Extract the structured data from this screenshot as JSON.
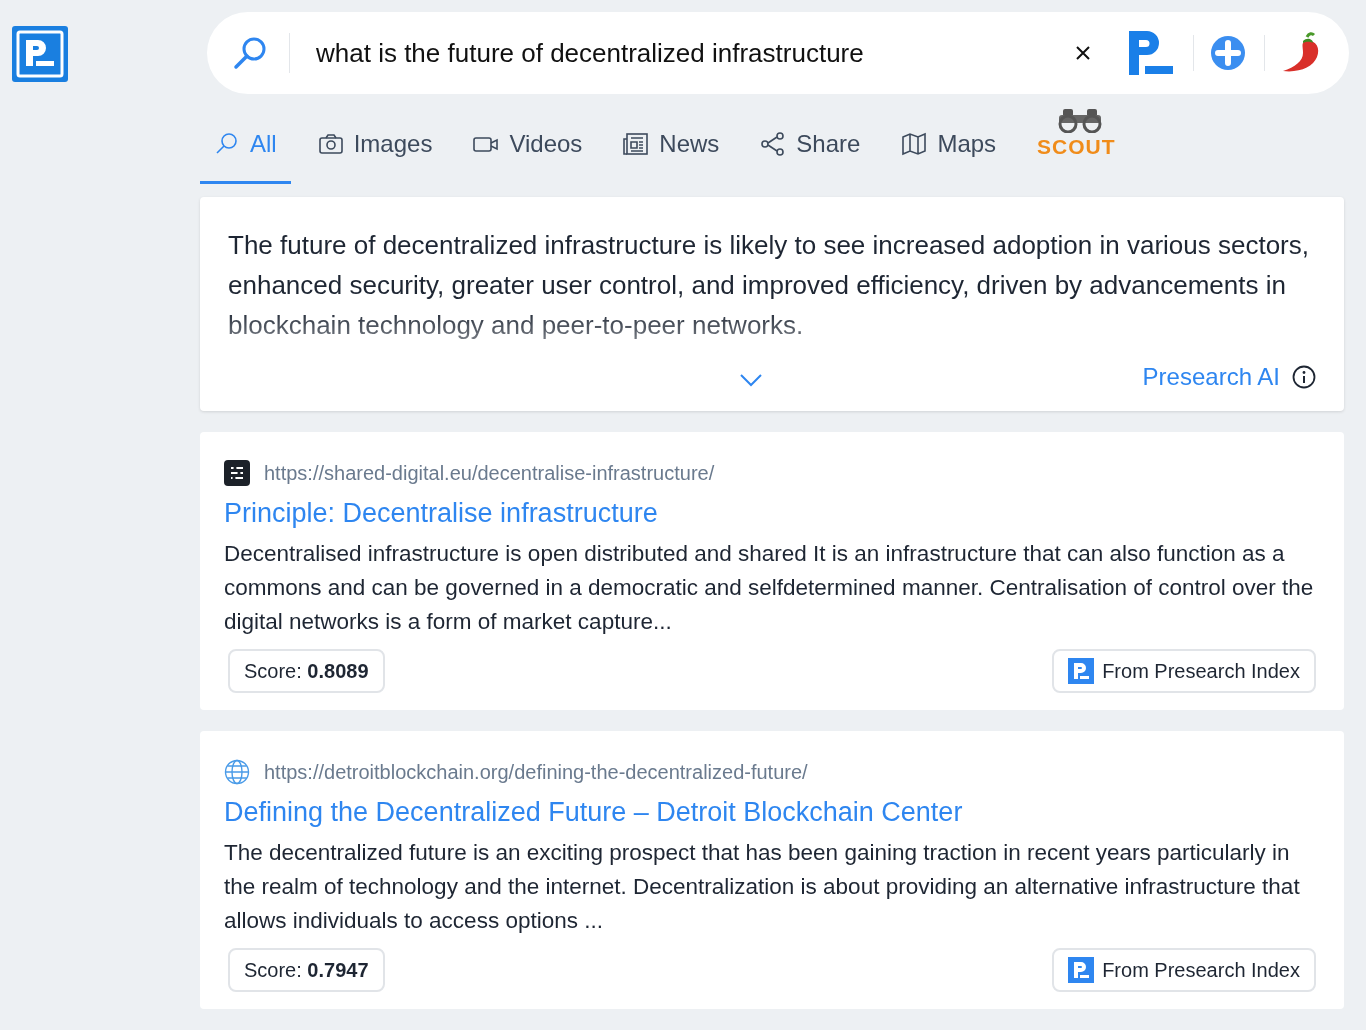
{
  "search": {
    "value": "what is the future of decentralized infrastructure"
  },
  "tabs": [
    {
      "label": "All",
      "kind": "search",
      "selected": true
    },
    {
      "label": "Images",
      "kind": "images",
      "selected": false
    },
    {
      "label": "Videos",
      "kind": "videos",
      "selected": false
    },
    {
      "label": "News",
      "kind": "news",
      "selected": false
    },
    {
      "label": "Share",
      "kind": "share",
      "selected": false
    },
    {
      "label": "Maps",
      "kind": "maps",
      "selected": false
    },
    {
      "label": "SCOUT",
      "kind": "scout",
      "selected": false
    }
  ],
  "ai_answer": {
    "text": "The future of decentralized infrastructure is likely to see increased adoption in various sectors, enhanced security, greater user control, and improved efficiency, driven by advancements in blockchain technology and peer-to-peer networks.",
    "source": "Presearch AI"
  },
  "results": [
    {
      "kind": "app",
      "url": "https://shared-digital.eu/decentralise-infrastructure/",
      "title": "Principle: Decentralise infrastructure",
      "snippet": "Decentralised infrastructure is open distributed and shared It is an infrastructure that can also function as a commons and can be governed in a democratic and selfdetermined manner. Centralisation of control over the digital networks is a form of market capture...",
      "score": "Score: **0.8089**",
      "origin": "From Presearch Index"
    },
    {
      "kind": "globe",
      "url": "https://detroitblockchain.org/defining-the-decentralized-future/",
      "title": "Defining the Decentralized Future – Detroit Blockchain Center",
      "snippet": "The decentralized future is an exciting prospect that has been gaining traction in recent years particularly in the realm of technology and the internet. Decentralization is about providing an alternative infrastructure that allows individuals to access options ...",
      "score": "Score: **0.7947**",
      "origin": "From Presearch Index"
    }
  ]
}
